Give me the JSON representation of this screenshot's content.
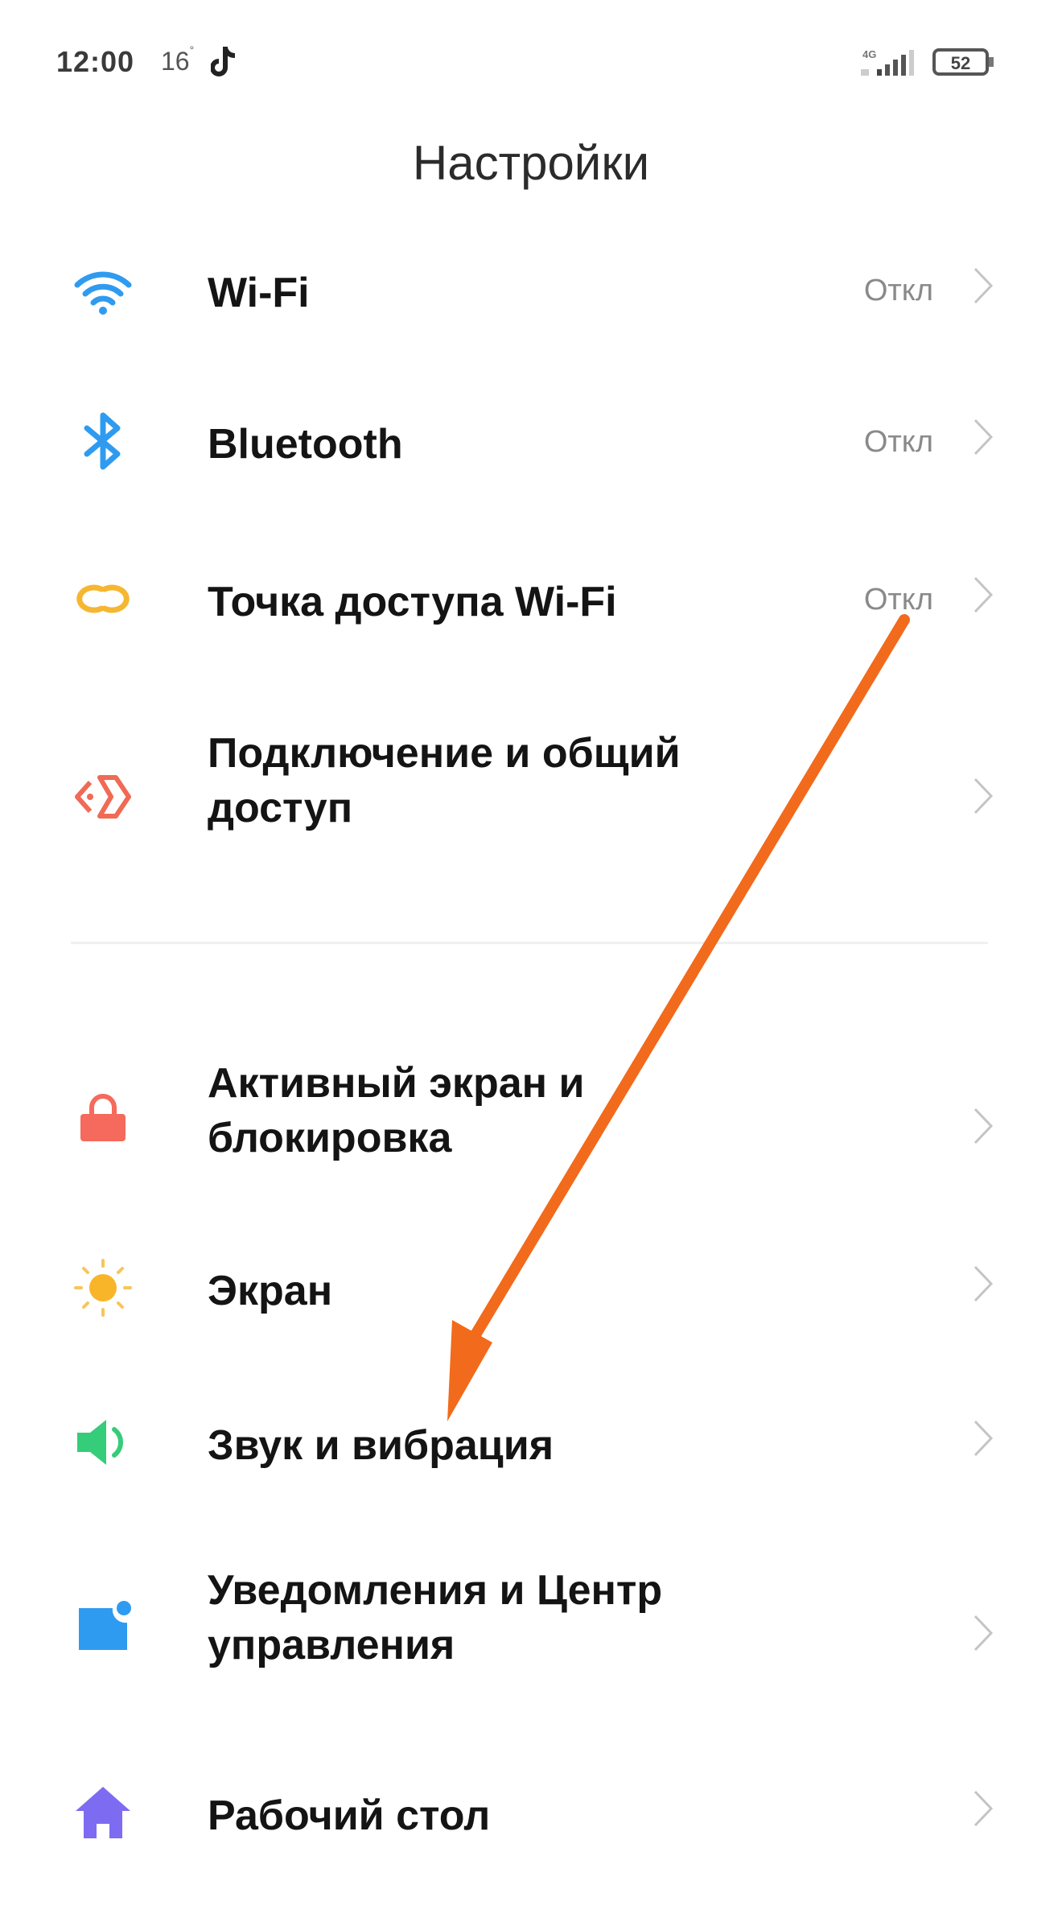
{
  "status_bar": {
    "time": "12:00",
    "temperature": "16",
    "temperature_unit": "°",
    "network_type": "4G",
    "battery_level": "52",
    "notification_icon": "tiktok-icon"
  },
  "header": {
    "title": "Настройки"
  },
  "settings": {
    "group1": [
      {
        "label": "Wi-Fi",
        "value": "Откл",
        "icon": "wifi-icon",
        "color": "#2f9bf0"
      },
      {
        "label": "Bluetooth",
        "value": "Откл",
        "icon": "bluetooth-icon",
        "color": "#2f9bf0"
      },
      {
        "label": "Точка доступа Wi-Fi",
        "value": "Откл",
        "icon": "hotspot-icon",
        "color": "#f5b731"
      },
      {
        "label_line1": "Подключение и общий",
        "label_line2": "доступ",
        "icon": "connection-sharing-icon",
        "color": "#f06a55"
      }
    ],
    "group2": [
      {
        "label_line1": "Активный экран и",
        "label_line2": "блокировка",
        "icon": "lock-icon",
        "color": "#f56a5d"
      },
      {
        "label": "Экран",
        "icon": "sun-icon",
        "color": "#f8b52a"
      },
      {
        "label": "Звук и вибрация",
        "icon": "speaker-icon",
        "color": "#35cc7a"
      },
      {
        "label_line1": "Уведомления и Центр",
        "label_line2": "управления",
        "icon": "notification-icon",
        "color": "#2f9bf0"
      },
      {
        "label": "Рабочий стол",
        "icon": "home-icon",
        "color": "#7d6cf2"
      }
    ]
  },
  "annotation": {
    "type": "arrow",
    "color": "#f26a1b",
    "from_item": "Точка доступа Wi-Fi",
    "to_item": "Звук и вибрация"
  }
}
